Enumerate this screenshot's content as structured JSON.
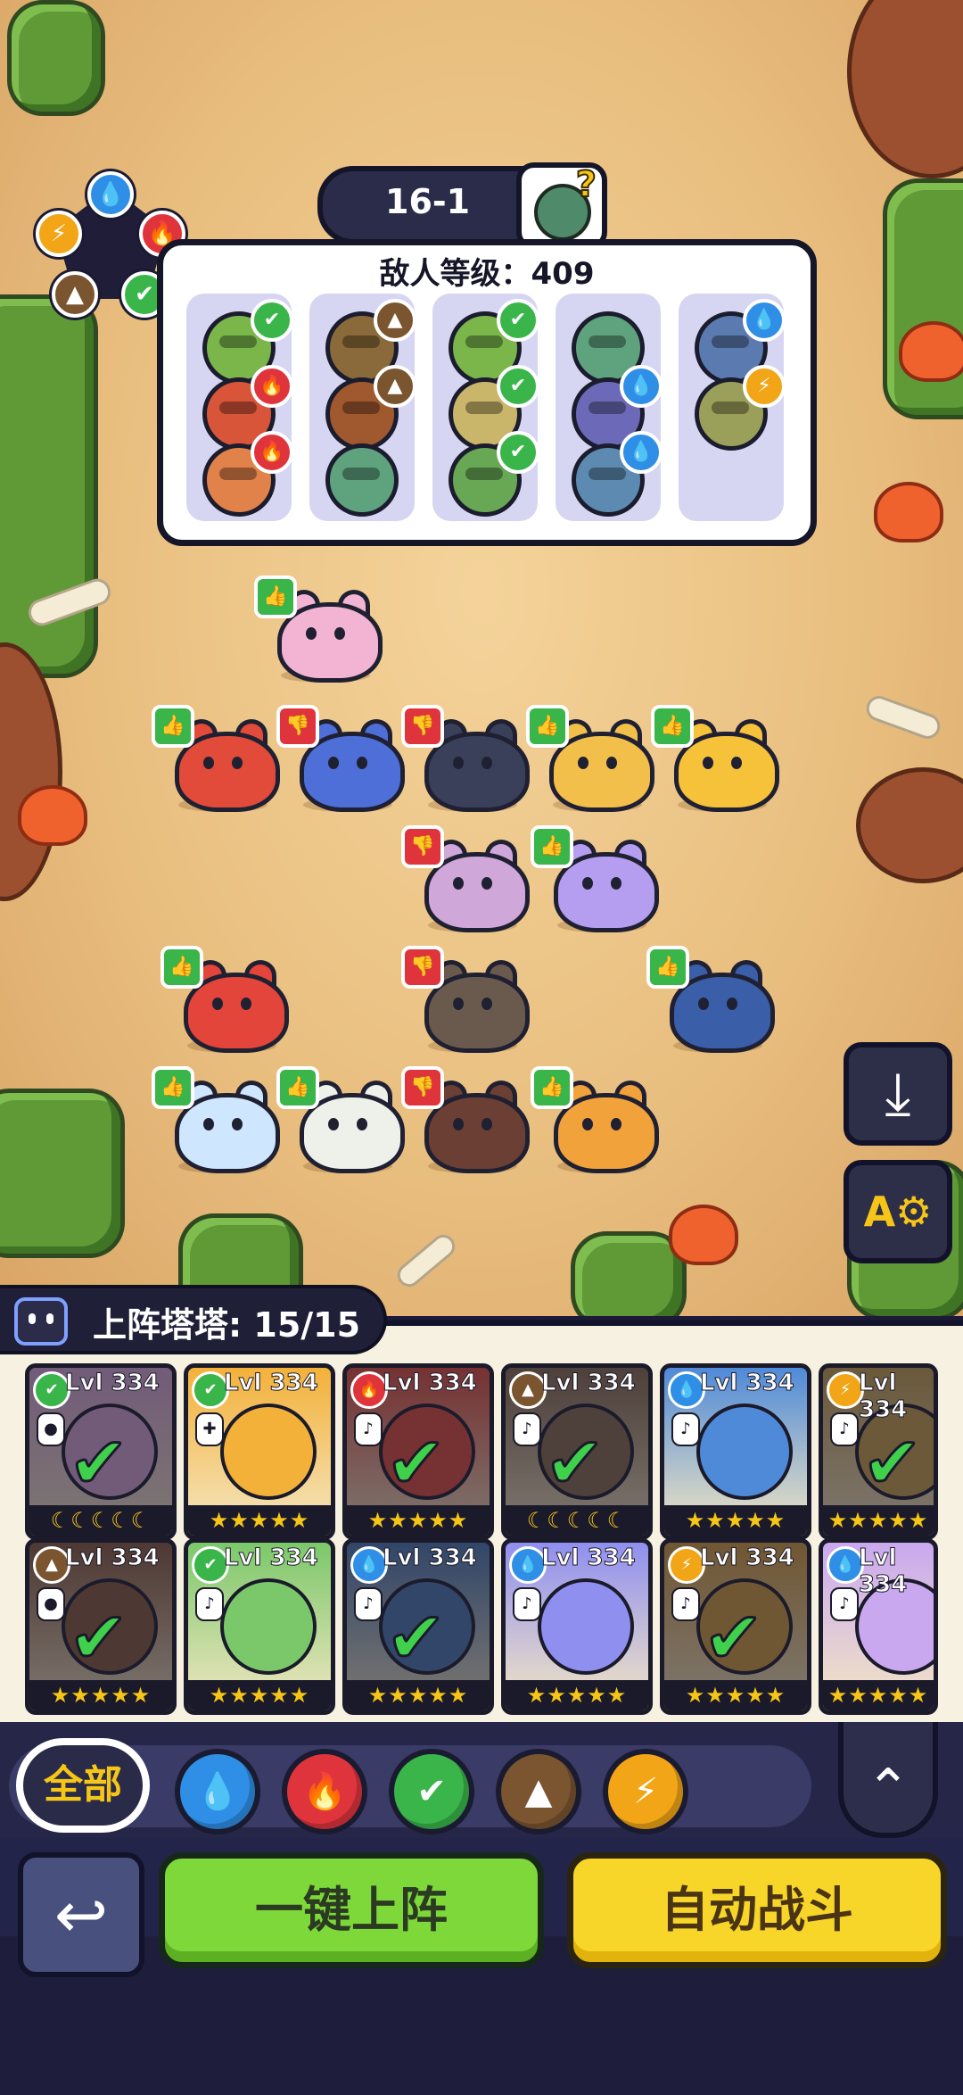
{
  "stage": {
    "label": "16-1",
    "help_glyph": "?"
  },
  "enemy_panel": {
    "title": "敌人等级：409",
    "columns": [
      {
        "monsters": [
          {
            "color": "#7ab64a",
            "element": "leaf"
          },
          {
            "color": "#d8553a",
            "element": "fire"
          },
          {
            "color": "#e0824a",
            "element": "fire"
          }
        ]
      },
      {
        "monsters": [
          {
            "color": "#8a6a3a",
            "element": "earth"
          },
          {
            "color": "#a0582e",
            "element": "earth"
          },
          {
            "color": "#5fa27e",
            "element": "none"
          }
        ]
      },
      {
        "monsters": [
          {
            "color": "#7ab64a",
            "element": "leaf"
          },
          {
            "color": "#c9b66a",
            "element": "leaf"
          },
          {
            "color": "#68a855",
            "element": "leaf"
          }
        ]
      },
      {
        "monsters": [
          {
            "color": "#5fa27e",
            "element": "none"
          },
          {
            "color": "#6c6ab8",
            "element": "water"
          },
          {
            "color": "#5c8ab0",
            "element": "water"
          }
        ]
      },
      {
        "monsters": [
          {
            "color": "#5b7ab0",
            "element": "water"
          },
          {
            "color": "#9aa05a",
            "element": "lightning"
          }
        ]
      }
    ]
  },
  "element_glyphs": {
    "water": "💧",
    "fire": "🔥",
    "leaf": "✔",
    "earth": "▲",
    "lightning": "⚡",
    "none": ""
  },
  "element_colors": {
    "water": "#2f8fe6",
    "fire": "#e0343d",
    "leaf": "#39b54a",
    "earth": "#7a5530",
    "lightning": "#f2a516",
    "none": "transparent"
  },
  "allies": [
    {
      "name": "pink-plant",
      "color": "#f2b4d2",
      "vote": "up"
    },
    {
      "name": "fire-cat",
      "color": "#e24b3a",
      "vote": "up"
    },
    {
      "name": "blue-fox",
      "color": "#4f6fd8",
      "vote": "down"
    },
    {
      "name": "raccoon",
      "color": "#3a3f5a",
      "vote": "down"
    },
    {
      "name": "golden-beast",
      "color": "#f2c04a",
      "vote": "up"
    },
    {
      "name": "yellow-fox",
      "color": "#f6c23a",
      "vote": "up"
    },
    {
      "name": "snail",
      "color": "#cfa7d8",
      "vote": "down"
    },
    {
      "name": "purple-lion",
      "color": "#b59ef0",
      "vote": "up"
    },
    {
      "name": "fire-dragon",
      "color": "#e4453a",
      "vote": "up"
    },
    {
      "name": "monkey",
      "color": "#6a5a4e",
      "vote": "down"
    },
    {
      "name": "whale",
      "color": "#3b5ea8",
      "vote": "up"
    },
    {
      "name": "ice-yeti",
      "color": "#cfe6ff",
      "vote": "up"
    },
    {
      "name": "panda",
      "color": "#eef0ea",
      "vote": "up"
    },
    {
      "name": "boar",
      "color": "#6c3f34",
      "vote": "down"
    },
    {
      "name": "deer",
      "color": "#f2a23a",
      "vote": "up"
    }
  ],
  "side_buttons": {
    "deploy_glyph": "⤓",
    "auto_settings_label": "A⚙"
  },
  "roster": {
    "label": "上阵塔塔: 15/15"
  },
  "cards": [
    {
      "level": "Lvl 334",
      "element": "leaf",
      "role": "●",
      "color": "#d8a7d6",
      "stars": "☾☾☾☾☾",
      "selected": true
    },
    {
      "level": "Lvl 334",
      "element": "leaf",
      "role": "✚",
      "color": "#f3b13a",
      "stars": "★★★★★",
      "selected": false
    },
    {
      "level": "Lvl 334",
      "element": "fire",
      "role": "♪",
      "color": "#e24b3a",
      "stars": "★★★★★",
      "selected": true
    },
    {
      "level": "Lvl 334",
      "element": "earth",
      "role": "♪",
      "color": "#8a6a4a",
      "stars": "☾☾☾☾☾",
      "selected": true
    },
    {
      "level": "Lvl 334",
      "element": "water",
      "role": "♪",
      "color": "#4f8ad8",
      "stars": "★★★★★",
      "selected": false
    },
    {
      "level": "Lvl 334",
      "element": "lightning",
      "role": "♪",
      "color": "#c9a24a",
      "stars": "★★★★★",
      "selected": true
    },
    {
      "level": "Lvl 334",
      "element": "earth",
      "role": "●",
      "color": "#8a5a3a",
      "stars": "★★★★★",
      "selected": true
    },
    {
      "level": "Lvl 334",
      "element": "leaf",
      "role": "♪",
      "color": "#7bc86a",
      "stars": "★★★★★",
      "selected": false
    },
    {
      "level": "Lvl 334",
      "element": "water",
      "role": "♪",
      "color": "#4a79b0",
      "stars": "★★★★★",
      "selected": true
    },
    {
      "level": "Lvl 334",
      "element": "water",
      "role": "♪",
      "color": "#8f8ff0",
      "stars": "★★★★★",
      "selected": false
    },
    {
      "level": "Lvl 334",
      "element": "lightning",
      "role": "♪",
      "color": "#d69e3a",
      "stars": "★★★★★",
      "selected": true
    },
    {
      "level": "Lvl 334",
      "element": "water",
      "role": "♪",
      "color": "#c9a8f0",
      "stars": "★★★★★",
      "selected": false
    }
  ],
  "filters": {
    "all_label": "全部",
    "elements": [
      "water",
      "fire",
      "leaf",
      "earth",
      "lightning"
    ]
  },
  "collapse_glyph": "⌃",
  "back_glyph": "↩",
  "auto_deploy_label": "一键上阵",
  "auto_battle_label": "自动战斗"
}
